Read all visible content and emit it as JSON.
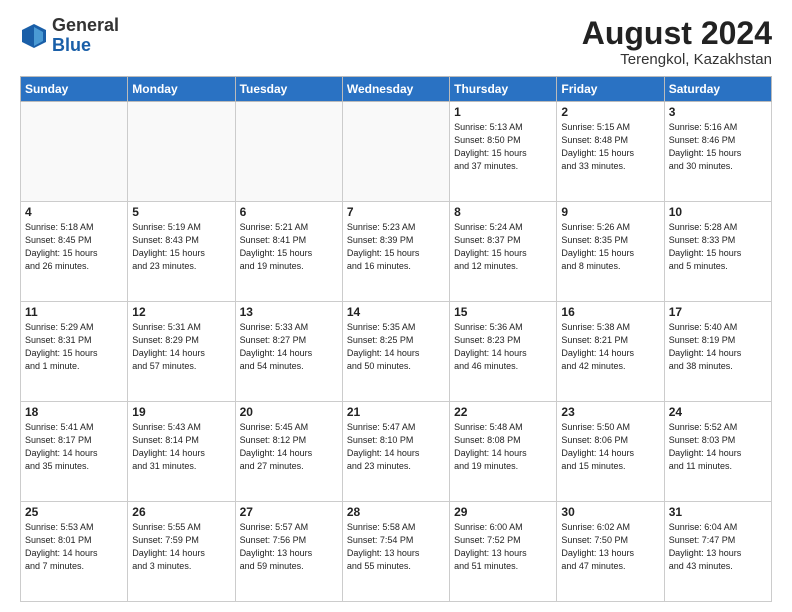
{
  "header": {
    "logo_general": "General",
    "logo_blue": "Blue",
    "month_year": "August 2024",
    "location": "Terengkol, Kazakhstan"
  },
  "days_of_week": [
    "Sunday",
    "Monday",
    "Tuesday",
    "Wednesday",
    "Thursday",
    "Friday",
    "Saturday"
  ],
  "weeks": [
    [
      {
        "num": "",
        "info": ""
      },
      {
        "num": "",
        "info": ""
      },
      {
        "num": "",
        "info": ""
      },
      {
        "num": "",
        "info": ""
      },
      {
        "num": "1",
        "info": "Sunrise: 5:13 AM\nSunset: 8:50 PM\nDaylight: 15 hours\nand 37 minutes."
      },
      {
        "num": "2",
        "info": "Sunrise: 5:15 AM\nSunset: 8:48 PM\nDaylight: 15 hours\nand 33 minutes."
      },
      {
        "num": "3",
        "info": "Sunrise: 5:16 AM\nSunset: 8:46 PM\nDaylight: 15 hours\nand 30 minutes."
      }
    ],
    [
      {
        "num": "4",
        "info": "Sunrise: 5:18 AM\nSunset: 8:45 PM\nDaylight: 15 hours\nand 26 minutes."
      },
      {
        "num": "5",
        "info": "Sunrise: 5:19 AM\nSunset: 8:43 PM\nDaylight: 15 hours\nand 23 minutes."
      },
      {
        "num": "6",
        "info": "Sunrise: 5:21 AM\nSunset: 8:41 PM\nDaylight: 15 hours\nand 19 minutes."
      },
      {
        "num": "7",
        "info": "Sunrise: 5:23 AM\nSunset: 8:39 PM\nDaylight: 15 hours\nand 16 minutes."
      },
      {
        "num": "8",
        "info": "Sunrise: 5:24 AM\nSunset: 8:37 PM\nDaylight: 15 hours\nand 12 minutes."
      },
      {
        "num": "9",
        "info": "Sunrise: 5:26 AM\nSunset: 8:35 PM\nDaylight: 15 hours\nand 8 minutes."
      },
      {
        "num": "10",
        "info": "Sunrise: 5:28 AM\nSunset: 8:33 PM\nDaylight: 15 hours\nand 5 minutes."
      }
    ],
    [
      {
        "num": "11",
        "info": "Sunrise: 5:29 AM\nSunset: 8:31 PM\nDaylight: 15 hours\nand 1 minute."
      },
      {
        "num": "12",
        "info": "Sunrise: 5:31 AM\nSunset: 8:29 PM\nDaylight: 14 hours\nand 57 minutes."
      },
      {
        "num": "13",
        "info": "Sunrise: 5:33 AM\nSunset: 8:27 PM\nDaylight: 14 hours\nand 54 minutes."
      },
      {
        "num": "14",
        "info": "Sunrise: 5:35 AM\nSunset: 8:25 PM\nDaylight: 14 hours\nand 50 minutes."
      },
      {
        "num": "15",
        "info": "Sunrise: 5:36 AM\nSunset: 8:23 PM\nDaylight: 14 hours\nand 46 minutes."
      },
      {
        "num": "16",
        "info": "Sunrise: 5:38 AM\nSunset: 8:21 PM\nDaylight: 14 hours\nand 42 minutes."
      },
      {
        "num": "17",
        "info": "Sunrise: 5:40 AM\nSunset: 8:19 PM\nDaylight: 14 hours\nand 38 minutes."
      }
    ],
    [
      {
        "num": "18",
        "info": "Sunrise: 5:41 AM\nSunset: 8:17 PM\nDaylight: 14 hours\nand 35 minutes."
      },
      {
        "num": "19",
        "info": "Sunrise: 5:43 AM\nSunset: 8:14 PM\nDaylight: 14 hours\nand 31 minutes."
      },
      {
        "num": "20",
        "info": "Sunrise: 5:45 AM\nSunset: 8:12 PM\nDaylight: 14 hours\nand 27 minutes."
      },
      {
        "num": "21",
        "info": "Sunrise: 5:47 AM\nSunset: 8:10 PM\nDaylight: 14 hours\nand 23 minutes."
      },
      {
        "num": "22",
        "info": "Sunrise: 5:48 AM\nSunset: 8:08 PM\nDaylight: 14 hours\nand 19 minutes."
      },
      {
        "num": "23",
        "info": "Sunrise: 5:50 AM\nSunset: 8:06 PM\nDaylight: 14 hours\nand 15 minutes."
      },
      {
        "num": "24",
        "info": "Sunrise: 5:52 AM\nSunset: 8:03 PM\nDaylight: 14 hours\nand 11 minutes."
      }
    ],
    [
      {
        "num": "25",
        "info": "Sunrise: 5:53 AM\nSunset: 8:01 PM\nDaylight: 14 hours\nand 7 minutes."
      },
      {
        "num": "26",
        "info": "Sunrise: 5:55 AM\nSunset: 7:59 PM\nDaylight: 14 hours\nand 3 minutes."
      },
      {
        "num": "27",
        "info": "Sunrise: 5:57 AM\nSunset: 7:56 PM\nDaylight: 13 hours\nand 59 minutes."
      },
      {
        "num": "28",
        "info": "Sunrise: 5:58 AM\nSunset: 7:54 PM\nDaylight: 13 hours\nand 55 minutes."
      },
      {
        "num": "29",
        "info": "Sunrise: 6:00 AM\nSunset: 7:52 PM\nDaylight: 13 hours\nand 51 minutes."
      },
      {
        "num": "30",
        "info": "Sunrise: 6:02 AM\nSunset: 7:50 PM\nDaylight: 13 hours\nand 47 minutes."
      },
      {
        "num": "31",
        "info": "Sunrise: 6:04 AM\nSunset: 7:47 PM\nDaylight: 13 hours\nand 43 minutes."
      }
    ]
  ]
}
